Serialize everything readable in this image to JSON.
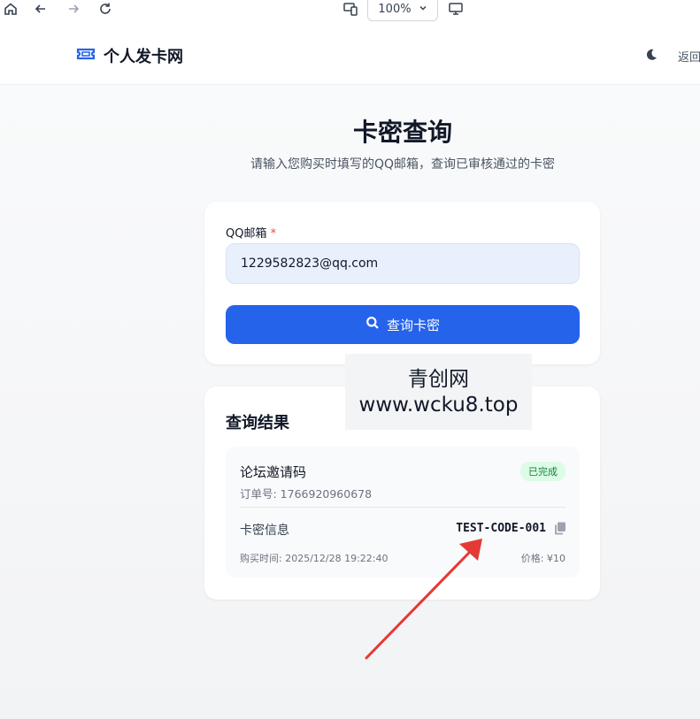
{
  "browser": {
    "zoom": "100%"
  },
  "header": {
    "site_name": "个人发卡网",
    "back_link": "返回"
  },
  "page": {
    "title": "卡密查询",
    "subtitle": "请输入您购买时填写的QQ邮箱，查询已审核通过的卡密"
  },
  "form": {
    "email_label": "QQ邮箱",
    "required_mark": "*",
    "email_value": "1229582823@qq.com",
    "submit_label": "查询卡密"
  },
  "result": {
    "title": "查询结果",
    "order": {
      "product": "论坛邀请码",
      "status": "已完成",
      "order_no": "订单号: 1766920960678",
      "code_label": "卡密信息",
      "code": "TEST-CODE-001",
      "purchase_time": "购买时间: 2025/12/28 19:22:40",
      "price": "价格: ¥10"
    }
  },
  "watermark": {
    "line1": "青创网",
    "line2": "www.wcku8.top"
  },
  "colors": {
    "primary": "#2563eb",
    "status_bg": "#dcfce7",
    "status_text": "#15803d",
    "annotation_arrow": "#e53935"
  }
}
